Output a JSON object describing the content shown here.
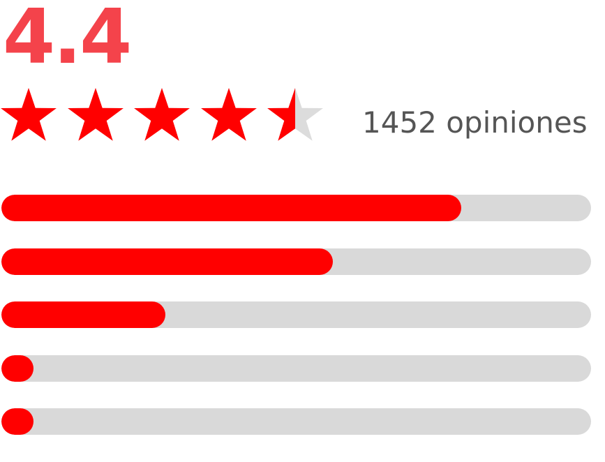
{
  "rating": {
    "score": "4.4",
    "stars_value": 4.4,
    "stars_max": 5,
    "count_label": "1452 opiniones"
  },
  "distribution": [
    {
      "fraction": 0.78
    },
    {
      "fraction": 0.562
    },
    {
      "fraction": 0.278
    },
    {
      "fraction": 0.055
    },
    {
      "fraction": 0.055
    }
  ],
  "colors": {
    "accent": "#ff0000",
    "score": "#f4434b",
    "star_empty": "#dcdcdc",
    "track": "#d9d9d9",
    "text": "#555555"
  },
  "icons": {
    "star": "star-icon"
  }
}
